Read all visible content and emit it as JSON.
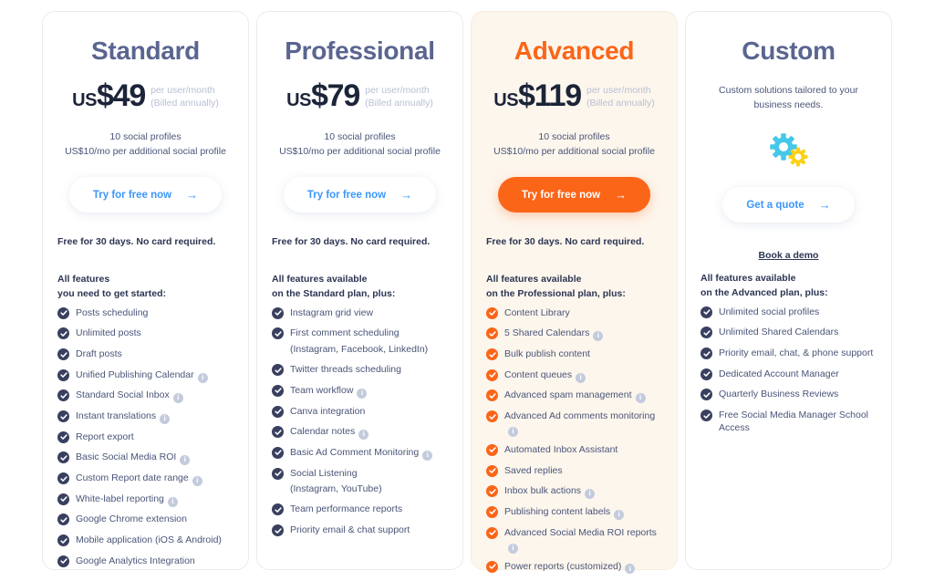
{
  "page": {
    "colors": {
      "accent_orange": "#fb6518",
      "link_blue": "#3b97fb",
      "heading_blue_gray": "#5a6590",
      "price_dark": "#1c2439",
      "featured_card_bg": "#fdf6ed",
      "check_dark": "#39405f",
      "info_gray": "#c3cbdd",
      "gear_cyan": "#45c8e8",
      "gear_yellow": "#fcd116"
    }
  },
  "plans": [
    {
      "id": "standard",
      "name": "Standard",
      "featured": false,
      "currency": "US",
      "price": "$49",
      "per": "per user/month",
      "billed": "(Billed annually)",
      "profiles_line1": "10 social profiles",
      "profiles_line2": "US$10/mo per additional social profile",
      "cta_label": "Try for free now",
      "cta_arrow": "→",
      "trial": "Free for 30 days. No card required.",
      "features_title": "All features\nyou need to get started:",
      "features": [
        {
          "label": "Posts scheduling",
          "info": false
        },
        {
          "label": "Unlimited posts",
          "info": false
        },
        {
          "label": "Draft posts",
          "info": false
        },
        {
          "label": "Unified Publishing Calendar",
          "info": true
        },
        {
          "label": "Standard Social Inbox",
          "info": true
        },
        {
          "label": "Instant translations",
          "info": true
        },
        {
          "label": "Report export",
          "info": false
        },
        {
          "label": "Basic Social Media ROI",
          "info": true
        },
        {
          "label": "Custom Report date range",
          "info": true
        },
        {
          "label": "White-label reporting",
          "info": true
        },
        {
          "label": "Google Chrome extension",
          "info": false
        },
        {
          "label": "Mobile application (iOS & Android)",
          "info": false
        },
        {
          "label": "Google Analytics Integration",
          "info": false
        }
      ]
    },
    {
      "id": "professional",
      "name": "Professional",
      "featured": false,
      "currency": "US",
      "price": "$79",
      "per": "per user/month",
      "billed": "(Billed annually)",
      "profiles_line1": "10 social profiles",
      "profiles_line2": "US$10/mo per additional social profile",
      "cta_label": "Try for free now",
      "cta_arrow": "→",
      "trial": "Free for 30 days. No card required.",
      "features_title": "All features available\non the Standard plan, plus:",
      "features": [
        {
          "label": "Instagram grid view",
          "info": false
        },
        {
          "label": "First comment scheduling",
          "sub": "(Instagram, Facebook, LinkedIn)",
          "info": false
        },
        {
          "label": "Twitter threads scheduling",
          "info": false
        },
        {
          "label": "Team workflow",
          "info": true
        },
        {
          "label": "Canva integration",
          "info": false
        },
        {
          "label": "Calendar notes",
          "info": true
        },
        {
          "label": "Basic Ad Comment Monitoring",
          "info": true
        },
        {
          "label": "Social Listening",
          "sub": "(Instagram, YouTube)",
          "info": false
        },
        {
          "label": "Team performance reports",
          "info": false
        },
        {
          "label": "Priority email & chat support",
          "info": false
        }
      ]
    },
    {
      "id": "advanced",
      "name": "Advanced",
      "featured": true,
      "currency": "US",
      "price": "$119",
      "per": "per user/month",
      "billed": "(Billed annually)",
      "profiles_line1": "10 social profiles",
      "profiles_line2": "US$10/mo per additional social profile",
      "cta_label": "Try for free now",
      "cta_arrow": "→",
      "trial": "Free for 30 days. No card required.",
      "features_title": "All features available\non the Professional plan, plus:",
      "features": [
        {
          "label": "Content Library",
          "info": false
        },
        {
          "label": "5 Shared Calendars",
          "info": true
        },
        {
          "label": "Bulk publish content",
          "info": false
        },
        {
          "label": "Content queues",
          "info": true
        },
        {
          "label": "Advanced spam management",
          "info": true
        },
        {
          "label": "Advanced Ad comments monitoring",
          "info": true
        },
        {
          "label": "Automated Inbox Assistant",
          "info": false
        },
        {
          "label": "Saved replies",
          "info": false
        },
        {
          "label": "Inbox bulk actions",
          "info": true
        },
        {
          "label": "Publishing content labels",
          "info": true
        },
        {
          "label": "Advanced Social Media ROI reports",
          "info": true
        },
        {
          "label": "Power reports (customized)",
          "info": true
        }
      ]
    },
    {
      "id": "custom",
      "name": "Custom",
      "featured": false,
      "description": "Custom solutions tailored to your business needs.",
      "icon": "gears-icon",
      "cta_label": "Get a quote",
      "cta_arrow": "→",
      "secondary_link": "Book a demo",
      "features_title": "All features available\non the Advanced plan, plus:",
      "features": [
        {
          "label": "Unlimited social profiles",
          "info": false
        },
        {
          "label": "Unlimited Shared Calendars",
          "info": false
        },
        {
          "label": "Priority email, chat, & phone support",
          "info": false
        },
        {
          "label": "Dedicated Account Manager",
          "info": false
        },
        {
          "label": "Quarterly Business Reviews",
          "info": false
        },
        {
          "label": "Free Social Media Manager School Access",
          "info": false
        }
      ]
    }
  ]
}
